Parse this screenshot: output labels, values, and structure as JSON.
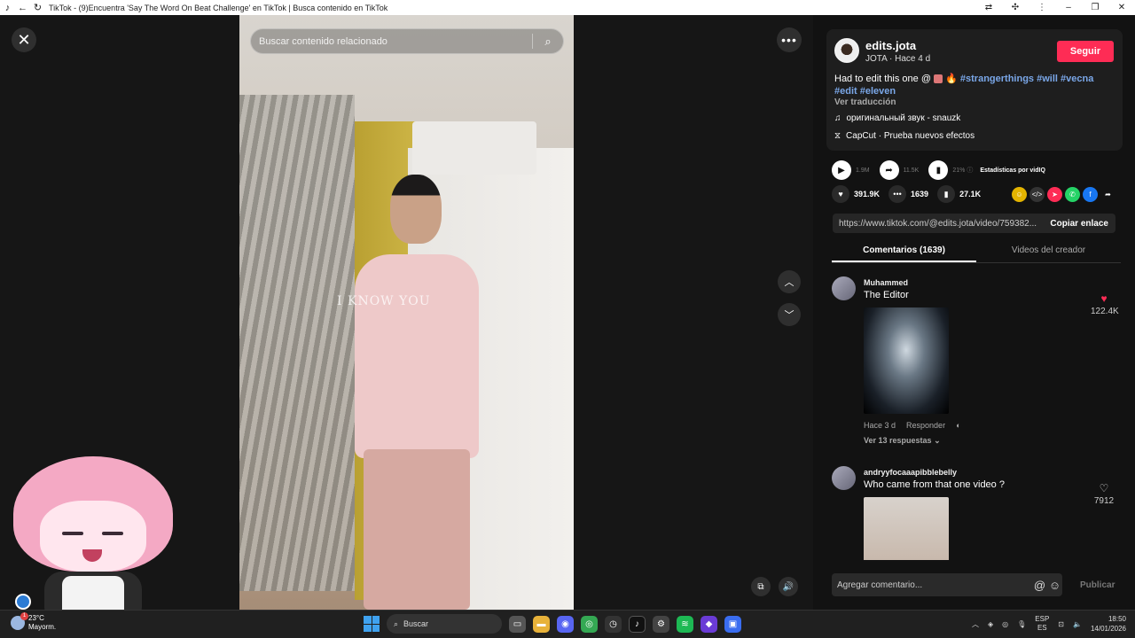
{
  "window": {
    "title": "TikTok - (9)Encuentra 'Say The Word On Beat Challenge' en TikTok | Busca contenido en TikTok"
  },
  "search": {
    "placeholder": "Buscar contenido relacionado"
  },
  "video": {
    "watermark": "I KNOW YOU"
  },
  "author": {
    "username": "edits.jota",
    "subtitle": "JOTA · Hace 4 d",
    "follow_label": "Seguir"
  },
  "description": {
    "text": "Had to edit this one @",
    "tags": [
      "#strangerthings",
      "#will",
      "#vecna",
      "#edit",
      "#eleven"
    ],
    "translate_label": "Ver traducción",
    "music": "оригинальный звук - snauzk",
    "effect": "CapCut · Prueba nuevos efectos"
  },
  "stats": {
    "plays": "1.9M",
    "shares": "11.5K",
    "percent": "21%",
    "vidiq_label": "Estadísticas por vidIQ"
  },
  "actions": {
    "likes": "391.9K",
    "comments": "1639",
    "saves": "27.1K"
  },
  "link": {
    "url": "https://www.tiktok.com/@edits.jota/video/759382...",
    "copy_label": "Copiar enlace"
  },
  "tabs": [
    {
      "label": "Comentarios (1639)",
      "active": true
    },
    {
      "label": "Videos del creador",
      "active": false
    }
  ],
  "comments": [
    {
      "user": "Muhammed",
      "text": "The Editor",
      "time": "Hace 3 d",
      "reply_label": "Responder",
      "replies_label": "Ver 13 respuestas",
      "likes": "122.4K",
      "liked": true
    },
    {
      "user": "andryyfocaaapibblebelly",
      "text": "Who came from that one video ?",
      "likes": "7912",
      "liked": false
    }
  ],
  "comment_input": {
    "placeholder": "Agregar comentario...",
    "publish_label": "Publicar"
  },
  "taskbar": {
    "weather_temp": "23°C",
    "weather_desc": "Mayorm.",
    "weather_badge": "1",
    "search_label": "Buscar",
    "lang_top": "ESP",
    "lang_bottom": "ES",
    "time": "18:50",
    "date": "14/01/2026"
  },
  "colors": {
    "accent": "#fe2c55",
    "hashtag": "#7aa7e8",
    "background": "#121212"
  }
}
